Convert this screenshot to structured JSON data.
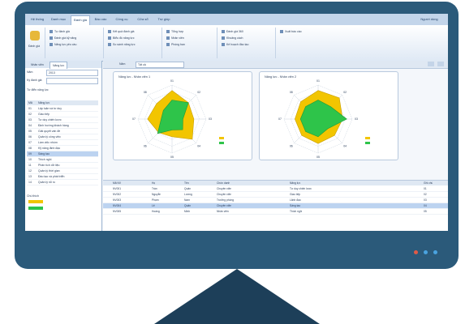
{
  "colors": {
    "bezel": "#2b5a7a",
    "stand": "#1d3f59",
    "screen_bg": "#eef3f8",
    "dot1": "#e05a47",
    "dot2": "#4aa3df",
    "dot3": "#4aa3df",
    "series_target": "#f2c500",
    "series_actual": "#2ec44a"
  },
  "tabs": [
    "Hệ thống",
    "Danh mục",
    "Đánh giá",
    "Báo cáo",
    "Công cụ",
    "Cửa sổ",
    "Trợ giúp"
  ],
  "window_user": "Người dùng",
  "ribbon": {
    "big_button": "Đánh giá",
    "groups": [
      {
        "items": [
          "Tự đánh giá",
          "Đánh giá kỹ năng",
          "Năng lực yêu cầu"
        ],
        "name": ""
      },
      {
        "items": [
          "Kết quả đánh giá",
          "Biểu đồ năng lực",
          "So sánh năng lực"
        ],
        "name": ""
      },
      {
        "items": [
          "Tổng hợp",
          "Nhân viên",
          "Phòng ban"
        ],
        "name": ""
      },
      {
        "items": [
          "Đánh giá 360",
          "Khoảng cách",
          "Kế hoạch đào tạo"
        ],
        "name": ""
      },
      {
        "items": [
          "Xuất báo cáo"
        ],
        "name": ""
      }
    ]
  },
  "left": {
    "tabs": [
      "Nhân viên",
      "Năng lực"
    ],
    "filter1_label": "Năm",
    "filter1_value": "2013",
    "filter2_label": "Kỳ đánh giá",
    "filter2_value": "",
    "filter3_label": "Từ điển năng lực",
    "list_headers": [
      "Mã",
      "Năng lực"
    ],
    "items": [
      {
        "code": "01",
        "name": "Lập luận và tư duy"
      },
      {
        "code": "02",
        "name": "Giao tiếp"
      },
      {
        "code": "03",
        "name": "Tư duy chiến lược"
      },
      {
        "code": "04",
        "name": "Định hướng khách hàng"
      },
      {
        "code": "05",
        "name": "Giải quyết vấn đề"
      },
      {
        "code": "06",
        "name": "Quản lý công việc"
      },
      {
        "code": "07",
        "name": "Làm việc nhóm"
      },
      {
        "code": "08",
        "name": "Kỹ năng lãnh đạo"
      },
      {
        "code": "09",
        "name": "Sáng tạo"
      },
      {
        "code": "10",
        "name": "Thích nghi"
      },
      {
        "code": "11",
        "name": "Phân tích dữ liệu"
      },
      {
        "code": "12",
        "name": "Quản lý thời gian"
      },
      {
        "code": "13",
        "name": "Đào tạo và phát triển"
      },
      {
        "code": "14",
        "name": "Quản lý rủi ro"
      }
    ],
    "selected_index": 8,
    "legend_title": "Chú thích",
    "legend_items": [
      {
        "name": "",
        "color": "#f2c500"
      },
      {
        "name": "",
        "color": "#2ec44a"
      }
    ]
  },
  "main": {
    "toolbar_label": "Năm",
    "toolbar_value": "Tất cả",
    "chart1_title": "Năng lực - Nhân viên 1",
    "chart2_title": "Năng lực - Nhân viên 2",
    "grid_headers": [
      "Mã NV",
      "Họ",
      "Tên",
      "Chức danh",
      "Năng lực",
      "Ghi chú"
    ],
    "grid_rows": [
      [
        "NV001",
        "Trần",
        "Quân",
        "Chuyên viên",
        "Tư duy chiến lược",
        "01"
      ],
      [
        "NV002",
        "Nguyễn",
        "Lương",
        "Chuyên viên",
        "Giao tiếp",
        "02"
      ],
      [
        "NV003",
        "Phạm",
        "Nam",
        "Trưởng phòng",
        "Lãnh đạo",
        "03"
      ],
      [
        "NV004",
        "Lê",
        "Quân",
        "Chuyên viên",
        "Sáng tạo",
        "04"
      ],
      [
        "NV005",
        "Hoàng",
        "Minh",
        "Nhân viên",
        "Thích nghi",
        "05"
      ]
    ],
    "grid_selected": 3
  },
  "chart_data": [
    {
      "type": "radar",
      "title": "Năng lực - Nhân viên 1",
      "categories": [
        "01",
        "02",
        "03",
        "04",
        "05",
        "06",
        "07",
        "08"
      ],
      "rmax": 5,
      "series": [
        {
          "name": "",
          "color": "#f2c500",
          "values": [
            4.2,
            3.4,
            3.2,
            4.2,
            2.6,
            2.8,
            3.6,
            3.2
          ]
        },
        {
          "name": "",
          "color": "#2ec44a",
          "values": [
            2.8,
            3.4,
            1.6,
            2.2,
            1.6,
            3.0,
            1.6,
            1.8
          ]
        }
      ]
    },
    {
      "type": "radar",
      "title": "Năng lực - Nhân viên 2",
      "categories": [
        "01",
        "02",
        "03",
        "04",
        "05",
        "06",
        "07",
        "08"
      ],
      "rmax": 5,
      "series": [
        {
          "name": "",
          "color": "#f2c500",
          "values": [
            4.2,
            4.4,
            3.6,
            3.4,
            3.6,
            3.4,
            3.4,
            3.6
          ]
        },
        {
          "name": "",
          "color": "#2ec44a",
          "values": [
            2.8,
            2.6,
            4.2,
            2.0,
            2.6,
            2.6,
            2.6,
            2.6
          ]
        }
      ]
    }
  ]
}
